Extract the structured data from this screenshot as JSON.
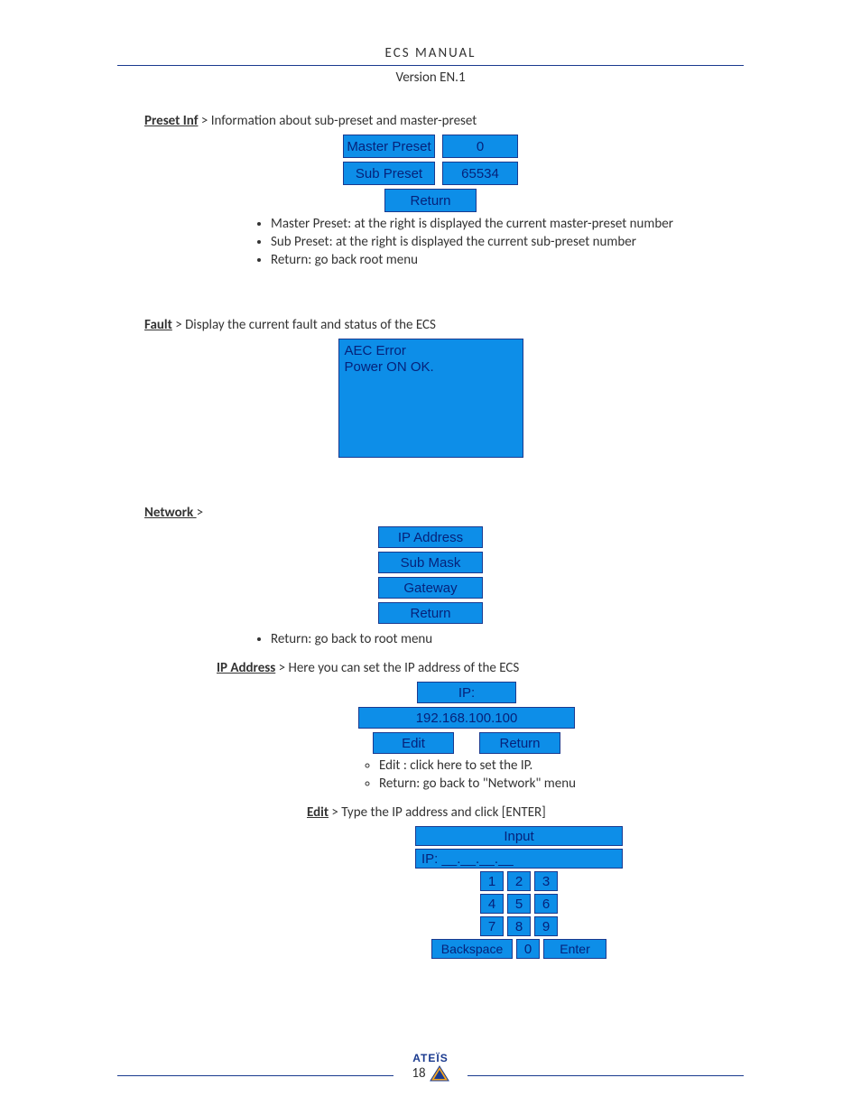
{
  "header": {
    "title": "ECS  MANUAL",
    "version": "Version EN.1"
  },
  "preset_inf": {
    "heading": "Preset Inf",
    "desc": " >  Information about sub-preset and master-preset",
    "panel": {
      "master_label": "Master Preset",
      "master_value": "0",
      "sub_label": "Sub Preset",
      "sub_value": "65534",
      "return": "Return"
    },
    "bullets": [
      "Master Preset: at the right is displayed the current master-preset number",
      "Sub Preset: at the right is displayed the current sub-preset number",
      "Return: go back root menu"
    ]
  },
  "fault": {
    "heading": "Fault",
    "desc": " > Display the current fault and status of the ECS",
    "lines": [
      "AEC Error",
      "Power ON OK."
    ]
  },
  "network": {
    "heading": "Network ",
    "gt": ">",
    "items": [
      "IP Address",
      "Sub Mask",
      "Gateway",
      "Return"
    ],
    "bullets": [
      "Return: go back to root menu"
    ]
  },
  "ip_address": {
    "heading": "IP Address",
    "desc": " > Here you can set the IP address of the ECS",
    "panel": {
      "header": "IP:",
      "value": "192.168.100.100",
      "edit": "Edit",
      "return": "Return"
    },
    "bullets": [
      "Edit : click here to set the IP.",
      "Return: go back to \"Network\" menu"
    ]
  },
  "edit": {
    "heading": "Edit",
    "desc": " > Type the IP address and click [ENTER]",
    "panel": {
      "input_header": "Input",
      "ip_row": "IP:   __.__.__.__",
      "keys": [
        [
          "1",
          "2",
          "3"
        ],
        [
          "4",
          "5",
          "6"
        ],
        [
          "7",
          "8",
          "9"
        ]
      ],
      "zero": "0",
      "backspace": "Backspace",
      "enter": "Enter"
    }
  },
  "footer": {
    "brand": "ATEÏS",
    "page_num": "18"
  }
}
